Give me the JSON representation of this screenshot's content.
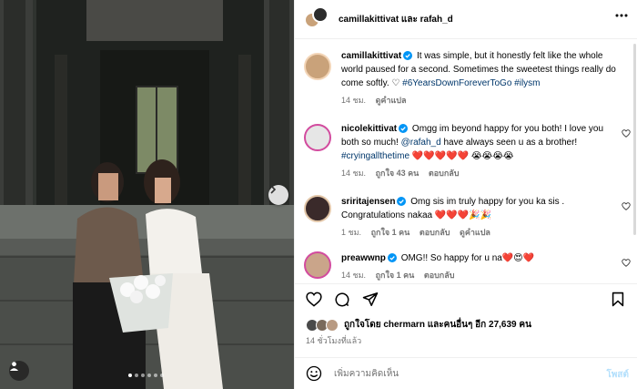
{
  "post": {
    "owner_names": "camillakittivat และ rafah_d"
  },
  "photo": {
    "slide_count": 6,
    "active_slide": 1
  },
  "comments": [
    {
      "username": "camillakittivat",
      "verified": true,
      "text": "It was simple, but it honestly felt like the whole world paused for a second. Sometimes the sweetest things really do come softly. ♡",
      "hashtags": "#6YearsDownForeverToGo #ilysm",
      "time": "14 ชม.",
      "translate": "ดูคำแปล",
      "avatar_color": "#c9a27a"
    },
    {
      "username": "nicolekittivat",
      "verified": true,
      "text_a": "Omgg im beyond happy for you both! I love you both so much!",
      "mention": "@rafah_d",
      "text_b": "have always seen u as a brother!",
      "hashtag": "#cryingallthetime",
      "emoji": "❤️❤️❤️❤️❤️ 😭😭😭😭",
      "time": "14 ชม.",
      "likes": "ถูกใจ 43 คน",
      "reply": "ตอบกลับ",
      "avatar_color": "#e0e0e0"
    },
    {
      "username": "sriritajensen",
      "verified": true,
      "text": "Omg sis im truly happy for you ka sis . Congratulations nakaa ❤️❤️❤️🎉🎉",
      "time": "1 ชม.",
      "likes": "ถูกใจ 1 คน",
      "reply": "ตอบกลับ",
      "translate": "ดูคำแปล",
      "avatar_color": "#3a2a2a"
    },
    {
      "username": "preawwnp",
      "verified": true,
      "text": "OMG!! So happy for u na❤️😍❤️",
      "time": "14 ชม.",
      "likes": "ถูกใจ 1 คน",
      "reply": "ตอบกลับ",
      "avatar_color": "#caa58a"
    }
  ],
  "likes_summary": {
    "text": "ถูกใจโดย chermarn และคนอื่นๆ อีก 27,639 คน"
  },
  "time_ago": "14 ชั่วโมงที่แล้ว",
  "add_comment": {
    "placeholder": "เพิ่มความคิดเห็น",
    "post_label": "โพสต์"
  },
  "colors": {
    "link": "#00376b",
    "muted": "#737373",
    "post_disabled": "#b2dffc",
    "verified": "#0095f6"
  }
}
